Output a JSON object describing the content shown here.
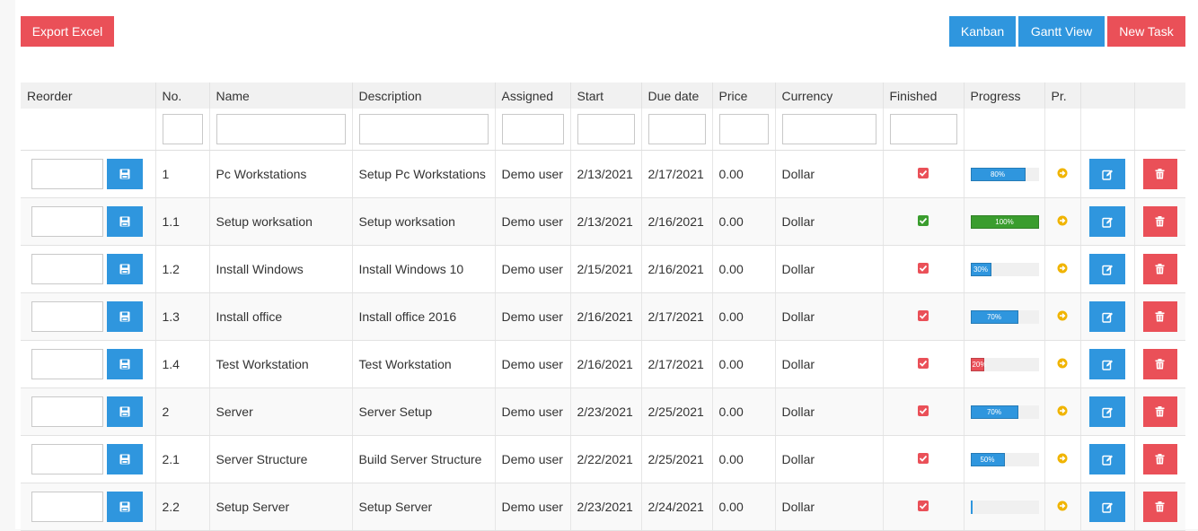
{
  "toolbar": {
    "export_label": "Export Excel",
    "kanban_label": "Kanban",
    "gantt_label": "Gantt View",
    "new_task_label": "New Task"
  },
  "columns": [
    "Reorder",
    "No.",
    "Name",
    "Description",
    "Assigned",
    "Start",
    "Due date",
    "Price",
    "Currency",
    "Finished",
    "Progress",
    "Pr.",
    "",
    ""
  ],
  "colors": {
    "danger": "#ea5058",
    "primary": "#2f96de",
    "success": "#3a9d2e",
    "warning": "#f0b400"
  },
  "icons": {
    "save": "floppy-disk-icon",
    "edit": "edit-icon",
    "delete": "trash-icon",
    "priority": "arrow-circle-right-icon",
    "finished": "checkbox-checked-icon"
  },
  "rows": [
    {
      "no": "1",
      "name": "Pc Workstations",
      "description": "Setup Pc Workstations",
      "assigned": "Demo user",
      "start": "2/13/2021",
      "due": "2/17/2021",
      "price": "0.00",
      "currency": "Dollar",
      "finished_color": "#ea5058",
      "progress": 80,
      "progress_label": "80%",
      "progress_color": "#2f96de"
    },
    {
      "no": "1.1",
      "name": "Setup worksation",
      "description": "Setup worksation",
      "assigned": "Demo user",
      "start": "2/13/2021",
      "due": "2/16/2021",
      "price": "0.00",
      "currency": "Dollar",
      "finished_color": "#3a9d2e",
      "progress": 100,
      "progress_label": "100%",
      "progress_color": "#3a9d2e"
    },
    {
      "no": "1.2",
      "name": "Install Windows",
      "description": "Install Windows 10",
      "assigned": "Demo user",
      "start": "2/15/2021",
      "due": "2/16/2021",
      "price": "0.00",
      "currency": "Dollar",
      "finished_color": "#ea5058",
      "progress": 30,
      "progress_label": "30%",
      "progress_color": "#2f96de"
    },
    {
      "no": "1.3",
      "name": "Install office",
      "description": "Install office 2016",
      "assigned": "Demo user",
      "start": "2/16/2021",
      "due": "2/17/2021",
      "price": "0.00",
      "currency": "Dollar",
      "finished_color": "#ea5058",
      "progress": 70,
      "progress_label": "70%",
      "progress_color": "#2f96de"
    },
    {
      "no": "1.4",
      "name": "Test Workstation",
      "description": "Test Workstation",
      "assigned": "Demo user",
      "start": "2/16/2021",
      "due": "2/17/2021",
      "price": "0.00",
      "currency": "Dollar",
      "finished_color": "#ea5058",
      "progress": 20,
      "progress_label": "20%",
      "progress_color": "#ea5058"
    },
    {
      "no": "2",
      "name": "Server",
      "description": "Server Setup",
      "assigned": "Demo user",
      "start": "2/23/2021",
      "due": "2/25/2021",
      "price": "0.00",
      "currency": "Dollar",
      "finished_color": "#ea5058",
      "progress": 70,
      "progress_label": "70%",
      "progress_color": "#2f96de"
    },
    {
      "no": "2.1",
      "name": "Server Structure",
      "description": "Build Server Structure",
      "assigned": "Demo user",
      "start": "2/22/2021",
      "due": "2/25/2021",
      "price": "0.00",
      "currency": "Dollar",
      "finished_color": "#ea5058",
      "progress": 50,
      "progress_label": "50%",
      "progress_color": "#2f96de"
    },
    {
      "no": "2.2",
      "name": "Setup Server",
      "description": "Setup Server",
      "assigned": "Demo user",
      "start": "2/23/2021",
      "due": "2/24/2021",
      "price": "0.00",
      "currency": "Dollar",
      "finished_color": "#ea5058",
      "progress": 0,
      "progress_label": "0%",
      "progress_color": "#2f96de"
    }
  ]
}
